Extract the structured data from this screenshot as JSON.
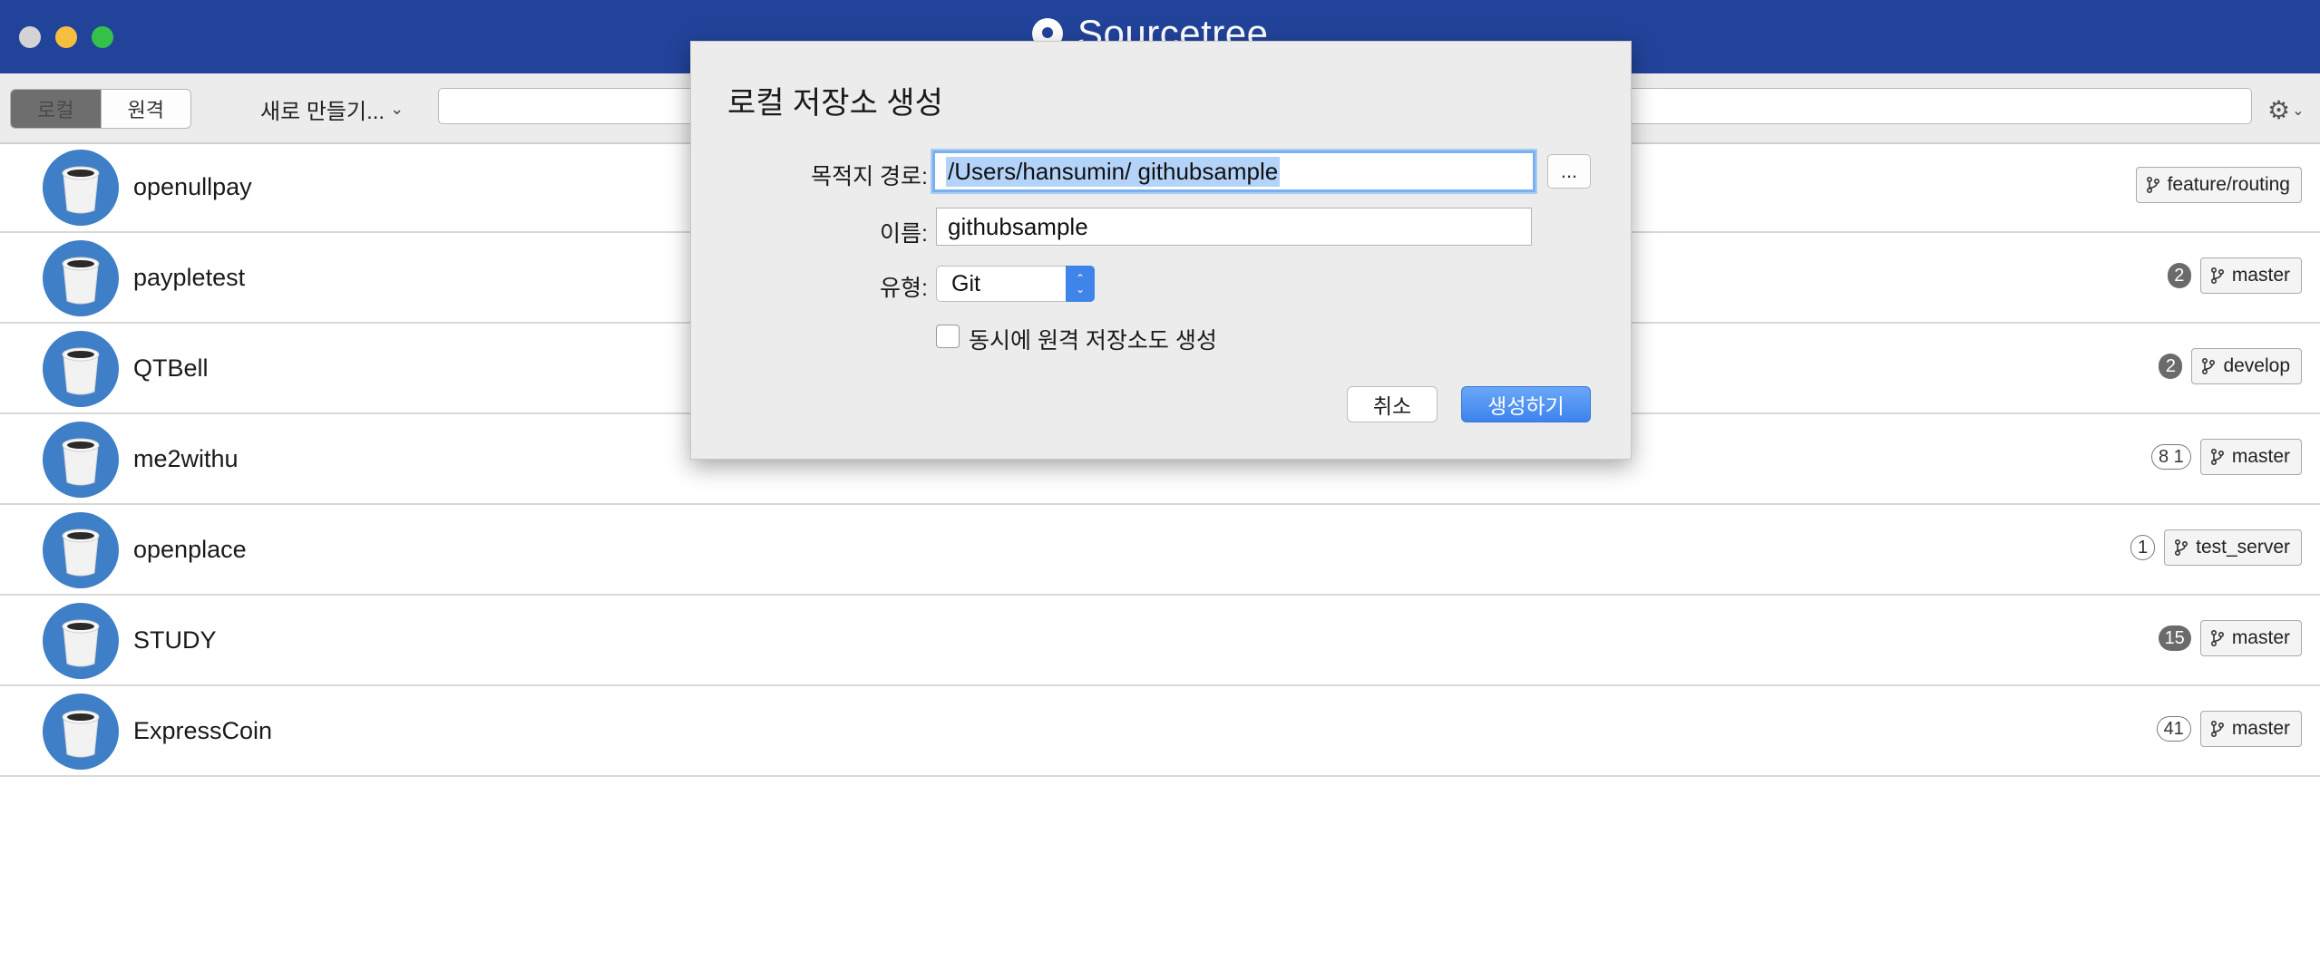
{
  "window": {
    "title": "Sourcetree"
  },
  "toolbar": {
    "tabs": [
      "로컬",
      "원격"
    ],
    "new_menu_label": "새로 만들기...",
    "search_placeholder": ""
  },
  "repositories": [
    {
      "name": "openullpay",
      "badge": "",
      "badge_style": "none",
      "branch": "feature/routing"
    },
    {
      "name": "paypletest",
      "badge": "2",
      "badge_style": "dark",
      "branch": "master"
    },
    {
      "name": "QTBell",
      "badge": "2",
      "badge_style": "dark",
      "branch": "develop"
    },
    {
      "name": "me2withu",
      "badge": "8 1",
      "badge_style": "outline",
      "branch": "master"
    },
    {
      "name": "openplace",
      "badge": "1",
      "badge_style": "outline",
      "branch": "test_server"
    },
    {
      "name": "STUDY",
      "badge": "15",
      "badge_style": "dark",
      "branch": "master"
    },
    {
      "name": "ExpressCoin",
      "badge": "41",
      "badge_style": "outline",
      "branch": "master"
    }
  ],
  "dialog": {
    "title": "로컬 저장소 생성",
    "path_label": "목적지 경로:",
    "path_value": "/Users/hansumin/ githubsample",
    "browse_label": "...",
    "name_label": "이름:",
    "name_value": "githubsample",
    "type_label": "유형:",
    "type_value": "Git",
    "remote_checkbox_label": "동시에 원격 저장소도 생성",
    "remote_checkbox_checked": false,
    "cancel_label": "취소",
    "create_label": "생성하기"
  },
  "colors": {
    "titlebar": "#22439a",
    "accent": "#3d83ee",
    "avatar": "#3e7fc7"
  }
}
